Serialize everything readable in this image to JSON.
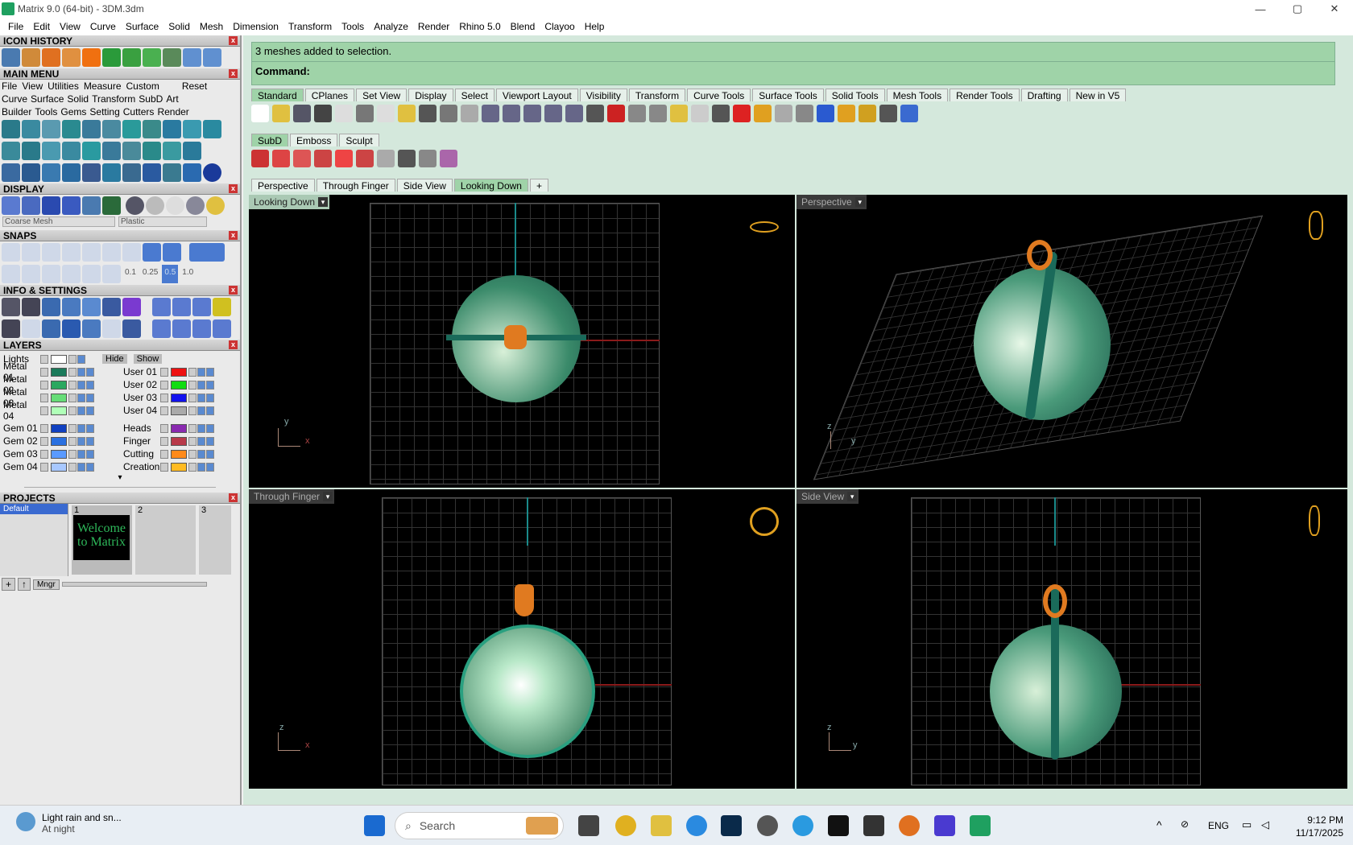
{
  "window": {
    "title": "Matrix 9.0 (64-bit) - 3DM.3dm",
    "min": "—",
    "max": "▢",
    "close": "✕"
  },
  "menu": [
    "File",
    "Edit",
    "View",
    "Curve",
    "Surface",
    "Solid",
    "Mesh",
    "Dimension",
    "Transform",
    "Tools",
    "Analyze",
    "Render",
    "Rhino 5.0",
    "Blend",
    "Clayoo",
    "Help"
  ],
  "left": {
    "icon_history": "ICON HISTORY",
    "main_menu": "MAIN MENU",
    "mm_row1": [
      "File",
      "View",
      "Utilities",
      "Measure",
      "Custom",
      "Reset"
    ],
    "mm_row2": [
      "Curve",
      "Surface",
      "Solid",
      "Transform",
      "SubD",
      "Art"
    ],
    "mm_row3": [
      "Builder",
      "Tools",
      "Gems",
      "Setting",
      "Cutters",
      "Render"
    ],
    "display": "DISPLAY",
    "display_mesh": "Coarse Mesh",
    "display_material": "Plastic",
    "snaps": "SNAPS",
    "snap_values": [
      "0.1",
      "0.25",
      "0.5",
      "1.0"
    ],
    "info": "INFO & SETTINGS",
    "layers": "LAYERS",
    "lights": "Lights",
    "hide": "Hide",
    "show": "Show",
    "layers_left": [
      {
        "name": "Metal 01",
        "color": "#1a7a5a"
      },
      {
        "name": "Metal 02",
        "color": "#2aa860"
      },
      {
        "name": "Metal 03",
        "color": "#66dd77"
      },
      {
        "name": "Metal 04",
        "color": "#b0ffb8"
      },
      {
        "name": "Gem 01",
        "color": "#1040c0"
      },
      {
        "name": "Gem 02",
        "color": "#2a70e0"
      },
      {
        "name": "Gem 03",
        "color": "#5a9aff"
      },
      {
        "name": "Gem 04",
        "color": "#a8c8ff"
      }
    ],
    "layers_right": [
      {
        "name": "User 01",
        "color": "#ee1111"
      },
      {
        "name": "User 02",
        "color": "#11dd11"
      },
      {
        "name": "User 03",
        "color": "#1111ee"
      },
      {
        "name": "User 04",
        "color": "#aaaaaa"
      },
      {
        "name": "Heads",
        "color": "#8a2ab0"
      },
      {
        "name": "Finger",
        "color": "#b83a4a"
      },
      {
        "name": "Cutting",
        "color": "#ff8a1a"
      },
      {
        "name": "Creation",
        "color": "#ffbb22"
      }
    ],
    "projects": "PROJECTS",
    "project_default": "Default",
    "project_slots": [
      "1",
      "2",
      "3"
    ],
    "welcome": "Welcome to Matrix",
    "mngr": "Mngr"
  },
  "command": {
    "message": "3 meshes added to selection.",
    "prompt": "Command:"
  },
  "tabs1": [
    "Standard",
    "CPlanes",
    "Set View",
    "Display",
    "Select",
    "Viewport Layout",
    "Visibility",
    "Transform",
    "Curve Tools",
    "Surface Tools",
    "Solid Tools",
    "Mesh Tools",
    "Render Tools",
    "Drafting",
    "New in V5"
  ],
  "tabs2": [
    "SubD",
    "Emboss",
    "Sculpt"
  ],
  "viewtabs": [
    "Perspective",
    "Through Finger",
    "Side View",
    "Looking Down"
  ],
  "viewports": {
    "tl": {
      "label": "Looking Down",
      "ax1": "y",
      "ax2": "x"
    },
    "tr": {
      "label": "Perspective",
      "ax1": "z",
      "ax2": "y"
    },
    "bl": {
      "label": "Through Finger",
      "ax1": "z",
      "ax2": "x"
    },
    "br": {
      "label": "Side View",
      "ax1": "z",
      "ax2": "y"
    }
  },
  "taskbar": {
    "weather_title": "Light rain and sn...",
    "weather_sub": "At night",
    "search": "Search",
    "lang": "ENG",
    "time": "9:12 PM",
    "date": "11/17/2025"
  }
}
